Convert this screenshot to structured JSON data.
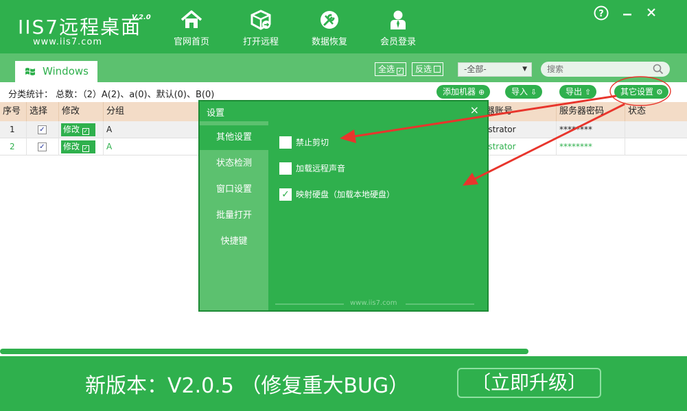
{
  "app": {
    "logo_text": "IIS7远程桌面",
    "version": "V.2.0",
    "url": "www.iis7.com"
  },
  "nav": [
    {
      "label": "官网首页",
      "icon": "home-icon"
    },
    {
      "label": "打开远程",
      "icon": "remote-box-icon"
    },
    {
      "label": "数据恢复",
      "icon": "repair-tools-icon"
    },
    {
      "label": "会员登录",
      "icon": "user-icon"
    }
  ],
  "window_controls": {
    "help": "?",
    "minimize": "–",
    "close": "×"
  },
  "tabs": [
    {
      "label": "Windows"
    }
  ],
  "toolbar": {
    "select_all": "全选",
    "invert": "反选",
    "group_filter": "-全部-",
    "search_placeholder": "搜索"
  },
  "stats": {
    "text": "分类统计：  总数：（2）A(2)、a(0)、默认(0)、B(0)"
  },
  "actions": {
    "add_machine": "添加机器",
    "import": "导入",
    "export": "导出",
    "other_settings": "其它设置"
  },
  "table": {
    "columns": [
      "序号",
      "选择",
      "修改",
      "分组",
      "器账号",
      "服务器密码",
      "状态"
    ],
    "rows": [
      {
        "index": "1",
        "checked": true,
        "edit": "修改",
        "group": "A",
        "account": "istrator",
        "password": "********",
        "status": ""
      },
      {
        "index": "2",
        "checked": true,
        "edit": "修改",
        "group": "A",
        "account": "istrator",
        "password": "********",
        "status": ""
      }
    ]
  },
  "modal": {
    "title": "设置",
    "close": "×",
    "sidebar": [
      "其他设置",
      "状态检测",
      "窗口设置",
      "批量打开",
      "快捷键"
    ],
    "active_index": 0,
    "options": [
      {
        "label": "禁止剪切",
        "checked": false
      },
      {
        "label": "加载远程声音",
        "checked": false
      },
      {
        "label": "映射硬盘（加载本地硬盘）",
        "checked": true
      }
    ],
    "footer": "www.iis7.com"
  },
  "banner": {
    "text": "新版本：V2.0.5 （修复重大BUG）",
    "upgrade_button": "〔立即升级〕"
  },
  "colors": {
    "primary_green": "#2fb04d",
    "light_green": "#5cc16f",
    "table_header": "#f3dcc7",
    "annotation_red": "#e8352c"
  }
}
